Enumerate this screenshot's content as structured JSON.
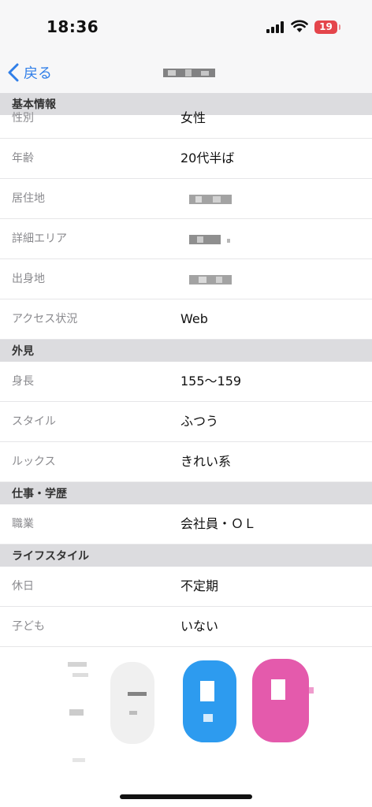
{
  "status_bar": {
    "time": "18:36",
    "battery_level": "19"
  },
  "nav": {
    "back_label": "戻る"
  },
  "sections": [
    {
      "header": "基本情報",
      "rows": [
        {
          "label": "性別",
          "value": "女性"
        },
        {
          "label": "年齢",
          "value": "20代半ば"
        },
        {
          "label": "居住地",
          "value": ""
        },
        {
          "label": "詳細エリア",
          "value": ""
        },
        {
          "label": "出身地",
          "value": ""
        },
        {
          "label": "アクセス状況",
          "value": "Web"
        }
      ]
    },
    {
      "header": "外見",
      "rows": [
        {
          "label": "身長",
          "value": "155～159"
        },
        {
          "label": "スタイル",
          "value": "ふつう"
        },
        {
          "label": "ルックス",
          "value": "きれい系"
        }
      ]
    },
    {
      "header": "仕事・学歴",
      "rows": [
        {
          "label": "職業",
          "value": "会社員・ＯＬ"
        }
      ]
    },
    {
      "header": "ライフスタイル",
      "rows": [
        {
          "label": "休日",
          "value": "不定期"
        },
        {
          "label": "子ども",
          "value": "いない"
        }
      ]
    }
  ],
  "colors": {
    "accent": "#2f7ee8",
    "battery": "#e4454b",
    "action_blue": "#2d9bef",
    "action_pink": "#e45aac"
  }
}
